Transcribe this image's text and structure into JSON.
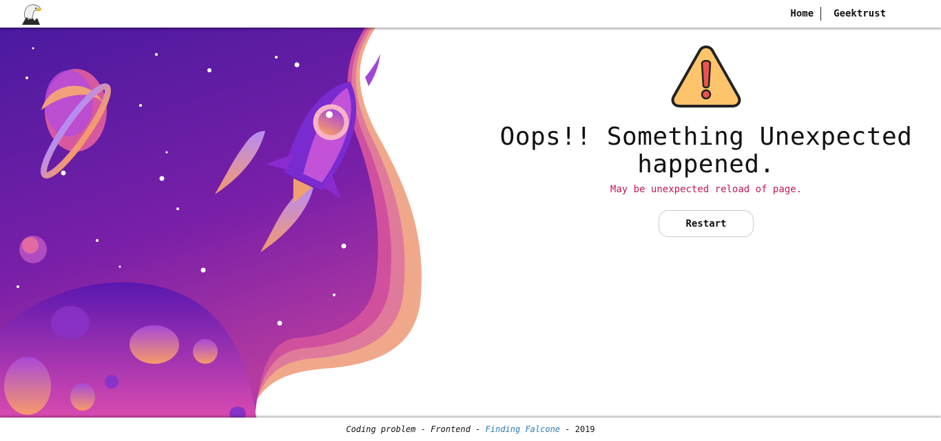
{
  "header": {
    "logo_icon": "eagle-icon",
    "nav": {
      "home_label": "Home",
      "geektrust_label": "Geektrust"
    }
  },
  "main": {
    "warning_icon": "warning-triangle-icon",
    "title": "Oops!! Something Unexpected happened.",
    "subtitle": "May be unexpected reload of page.",
    "restart_label": "Restart"
  },
  "footer": {
    "part1": "Coding problem - Frontend - ",
    "link_text": "Finding Falcone",
    "separator": " - ",
    "year": "2019"
  },
  "colors": {
    "accent_text": "#c2185b",
    "link": "#2a7ab8",
    "hero_purple": "#5b21b6",
    "hero_pink": "#e0458a",
    "warning_yellow": "#fdc46b"
  }
}
